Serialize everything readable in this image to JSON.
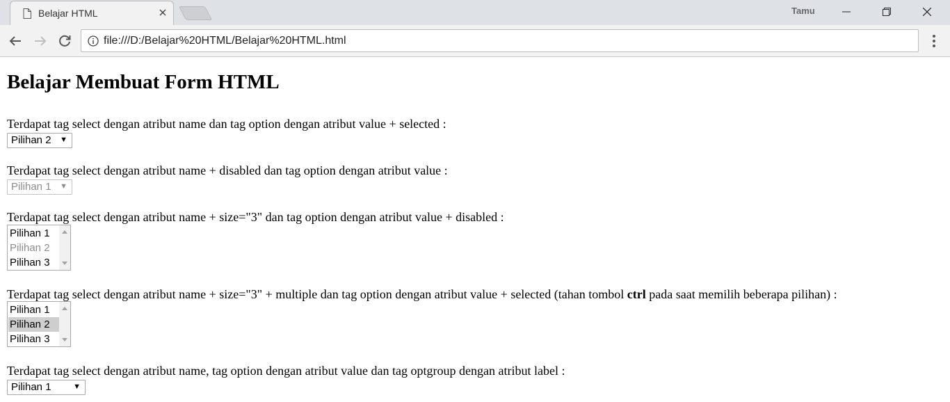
{
  "browser": {
    "tab_title": "Belajar HTML",
    "profile_label": "Tamu",
    "url": "file:///D:/Belajar%20HTML/Belajar%20HTML.html"
  },
  "page": {
    "heading": "Belajar Membuat Form HTML",
    "sections": [
      {
        "text": "Terdapat tag select dengan atribut name dan tag option dengan atribut value + selected :",
        "select_value": "Pilihan 2"
      },
      {
        "text": "Terdapat tag select dengan atribut name + disabled dan tag option dengan atribut value :",
        "select_value": "Pilihan 1"
      },
      {
        "text": "Terdapat tag select dengan atribut name + size=\"3\" dan tag option dengan atribut value + disabled :",
        "options": [
          "Pilihan 1",
          "Pilihan 2",
          "Pilihan 3"
        ]
      },
      {
        "text_before": "Terdapat tag select dengan atribut name + size=\"3\" + multiple dan tag option dengan atribut value + selected (tahan tombol ",
        "text_bold": "ctrl",
        "text_after": " pada saat memilih beberapa pilihan) :",
        "options": [
          "Pilihan 1",
          "Pilihan 2",
          "Pilihan 3"
        ]
      },
      {
        "text": "Terdapat tag select dengan atribut name, tag option dengan atribut value dan tag optgroup dengan atribut label :",
        "select_value": "Pilihan 1"
      }
    ]
  },
  "icons": {
    "tab_page": "page-icon",
    "tab_close": "close-icon",
    "minimize": "minimize-icon",
    "restore": "restore-icon",
    "window_close": "close-icon",
    "back": "back-arrow-icon",
    "forward": "forward-arrow-icon",
    "reload": "reload-icon",
    "site_info": "info-icon",
    "menu": "kebab-menu-icon",
    "dropdown": "triangle-down-icon"
  }
}
